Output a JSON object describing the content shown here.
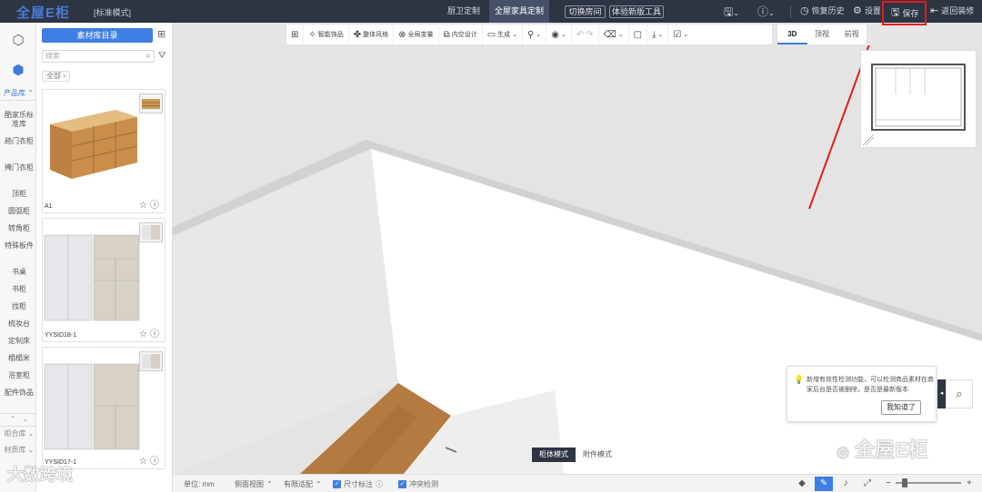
{
  "header": {
    "logo": "全屋E柜",
    "mode": "[标准模式]",
    "tabs": [
      {
        "label": "厨卫定制",
        "active": false
      },
      {
        "label": "全屋家具定制",
        "active": true
      }
    ],
    "buttons": [
      "切换房间",
      "体验新版工具"
    ],
    "restore_history": "恢复历史",
    "settings": "设置",
    "save": "保存",
    "back": "返回装修"
  },
  "rail": {
    "section_label": "产品库",
    "items": [
      "酷家乐标准库",
      "趟门衣柜",
      "掩门衣柜",
      "顶柜",
      "圆弧柜",
      "转角柜",
      "特殊板件",
      "书桌",
      "书柜",
      "找柜",
      "梳妆台",
      "定制床",
      "榻榻米",
      "浴室柜",
      "配件饰品"
    ],
    "bottom_labels": [
      "组合库",
      "材质库"
    ]
  },
  "library": {
    "catalog_button": "素材库目录",
    "search_placeholder": "搜索",
    "breadcrumb": "全部 ›",
    "items": [
      {
        "name": "A1"
      },
      {
        "name": "YYSID18-1"
      },
      {
        "name": "YYSID17-1"
      }
    ]
  },
  "toolbar": {
    "items": [
      {
        "label": "",
        "icon": "layout-icon"
      },
      {
        "label": "智能饰品",
        "icon": "sparkle-icon"
      },
      {
        "label": "整体风格",
        "icon": "palette-icon"
      },
      {
        "label": "全局变量",
        "icon": "globe-icon"
      },
      {
        "label": "内空设计",
        "icon": "cube-icon"
      },
      {
        "label": "生成",
        "icon": "generate-icon"
      }
    ],
    "view_tabs": [
      {
        "label": "3D",
        "active": true
      },
      {
        "label": "顶视",
        "active": false
      },
      {
        "label": "前视",
        "active": false
      }
    ]
  },
  "canvas": {
    "tip_text": "新增有效性检测功能，可以检测商品素材在商家后台是否被删除，是否是最新版本",
    "tip_button": "我知道了",
    "modes": [
      {
        "label": "柜体模式",
        "active": true
      },
      {
        "label": "附件模式",
        "active": false
      }
    ]
  },
  "statusbar": {
    "unit": "单位: mm",
    "side_view": "侧面视图",
    "auto_fit": "有限适配",
    "size_label": "尺寸标注",
    "collision": "冲突检测"
  },
  "watermark": {
    "right": "全屋E柜",
    "left": "大数跨境"
  },
  "colors": {
    "topbar": "#2d3442",
    "accent": "#3f7ee3",
    "highlight": "#e21d1d"
  }
}
